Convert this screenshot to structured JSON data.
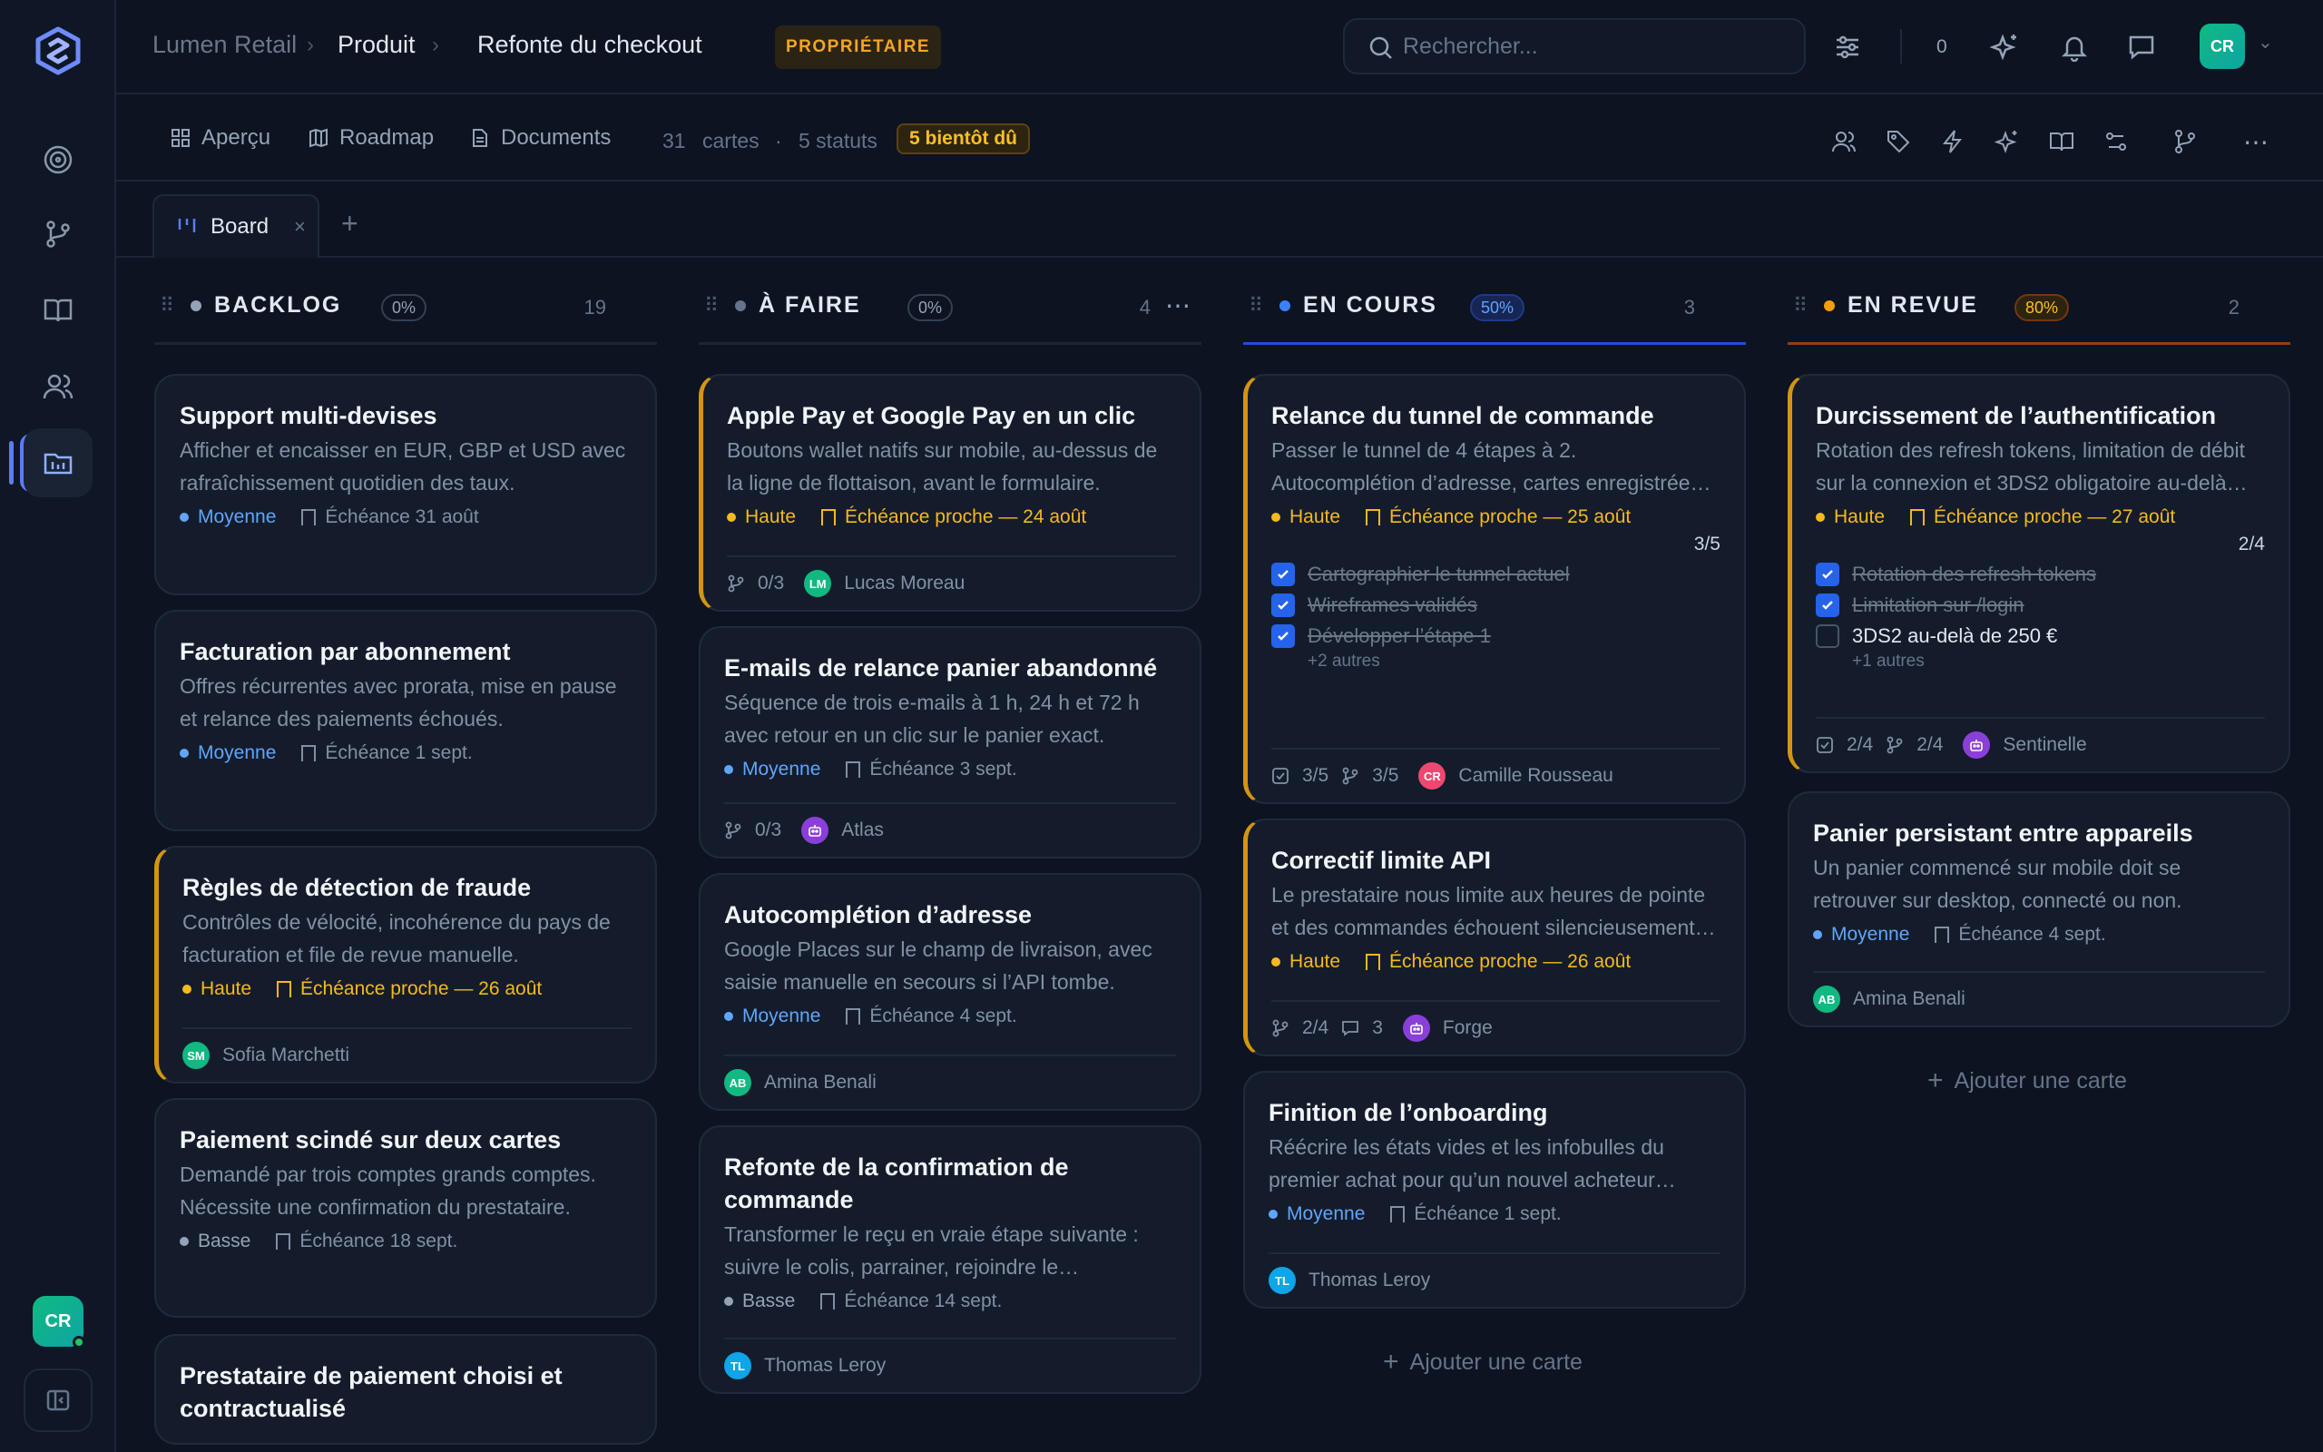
{
  "colors": {
    "accent": "#5b7cf7",
    "high": "#f5b91f",
    "medium": "#60a5fa",
    "low": "#94a3b8",
    "progress_blue": "#3b82f6",
    "review_orange": "#f59e0b"
  },
  "user": {
    "initials": "CR"
  },
  "breadcrumb": {
    "org": "Lumen Retail",
    "section": "Produit",
    "page": "Refonte du checkout",
    "role_badge": "PROPRIÉTAIRE"
  },
  "search": {
    "placeholder": "Rechercher..."
  },
  "topbar": {
    "notif_count": "0"
  },
  "subtabs": [
    {
      "label": "Aperçu",
      "icon": "grid-icon"
    },
    {
      "label": "Roadmap",
      "icon": "map-icon"
    },
    {
      "label": "Documents",
      "icon": "document-icon"
    }
  ],
  "stats": {
    "cards": "31",
    "cards_label": "cartes",
    "statuses": "5 statuts",
    "due_soon": "5 bientôt dû"
  },
  "view": {
    "tab_label": "Board"
  },
  "columns": [
    {
      "title": "BACKLOG",
      "percent": "0%",
      "count": "19",
      "dot": "#94a3b8",
      "cards": [
        {
          "title": "Support multi-devises",
          "desc": "Afficher et encaisser en EUR, GBP et USD avec rafraîchissement quotidien des taux.",
          "priority": "Moyenne",
          "due": "Échéance 31 août"
        },
        {
          "title": "Facturation par abonnement",
          "desc": "Offres récurrentes avec prorata, mise en pause et relance des paiements échoués.",
          "priority": "Moyenne",
          "due": "Échéance 1 sept."
        },
        {
          "title": "Règles de détection de fraude",
          "desc": "Contrôles de vélocité, incohérence du pays de facturation et file de revue manuelle.",
          "priority": "Haute",
          "due": "Échéance proche — 26 août",
          "assignee": "Sofia Marchetti",
          "assignee_initials": "SM"
        },
        {
          "title": "Paiement scindé sur deux cartes",
          "desc": "Demandé par trois comptes grands comptes. Nécessite une confirmation du prestataire.",
          "priority": "Basse",
          "due": "Échéance 18 sept."
        },
        {
          "title": "Prestataire de paiement choisi et contractualisé"
        }
      ]
    },
    {
      "title": "À FAIRE",
      "percent": "0%",
      "count": "4",
      "dot": "#64748b",
      "cards": [
        {
          "title": "Apple Pay et Google Pay en un clic",
          "desc": "Boutons wallet natifs sur mobile, au-dessus de la ligne de flottaison, avant le formulaire.",
          "priority": "Haute",
          "due": "Échéance proche — 24 août",
          "branches": "0/3",
          "assignee": "Lucas Moreau",
          "assignee_initials": "LM"
        },
        {
          "title": "E-mails de relance panier abandonné",
          "desc": "Séquence de trois e-mails à 1 h, 24 h et 72 h avec retour en un clic sur le panier exact.",
          "priority": "Moyenne",
          "due": "Échéance 3 sept.",
          "branches": "0/3",
          "assignee": "Atlas"
        },
        {
          "title": "Autocomplétion d’adresse",
          "desc": "Google Places sur le champ de livraison, avec saisie manuelle en secours si l’API tombe.",
          "priority": "Moyenne",
          "due": "Échéance 4 sept.",
          "assignee": "Amina Benali",
          "assignee_initials": "AB"
        },
        {
          "title": "Refonte de la confirmation de commande",
          "desc": "Transformer le reçu en vraie étape suivante : suivre le colis, parrainer, rejoindre le…",
          "priority": "Basse",
          "due": "Échéance 14 sept.",
          "assignee": "Thomas Leroy",
          "assignee_initials": "TL"
        }
      ]
    },
    {
      "title": "EN COURS",
      "percent": "50%",
      "count": "3",
      "dot": "#3b82f6",
      "cards": [
        {
          "title": "Relance du tunnel de commande",
          "desc": "Passer le tunnel de 4 étapes à 2. Autocomplétion d’adresse, cartes enregistrée…",
          "priority": "Haute",
          "due": "Échéance proche — 25 août",
          "progress": "3/5",
          "checklist": [
            "Cartographier le tunnel actuel",
            "Wireframes validés",
            "Développer l’étape 1"
          ],
          "more": "+2 autres",
          "tasks": "3/5",
          "branches": "3/5",
          "assignee": "Camille Rousseau",
          "assignee_initials": "CR"
        },
        {
          "title": "Correctif limite API",
          "desc": "Le prestataire nous limite aux heures de pointe et des commandes échouent silencieusement…",
          "priority": "Haute",
          "due": "Échéance proche — 26 août",
          "branches": "2/4",
          "comments": "3",
          "assignee": "Forge"
        },
        {
          "title": "Finition de l’onboarding",
          "desc": "Réécrire les états vides et les infobulles du premier achat pour qu’un nouvel acheteur…",
          "priority": "Moyenne",
          "due": "Échéance 1 sept.",
          "assignee": "Thomas Leroy",
          "assignee_initials": "TL"
        }
      ]
    },
    {
      "title": "EN REVUE",
      "percent": "80%",
      "count": "2",
      "dot": "#f59e0b",
      "cards": [
        {
          "title": "Durcissement de l’authentification",
          "desc": "Rotation des refresh tokens, limitation de débit sur la connexion et 3DS2 obligatoire au-delà…",
          "priority": "Haute",
          "due": "Échéance proche — 27 août",
          "progress": "2/4",
          "checklist": [
            "Rotation des refresh tokens",
            "Limitation sur /login",
            "3DS2 au-delà de 250 €"
          ],
          "more": "+1 autres",
          "tasks": "2/4",
          "branches": "2/4",
          "assignee": "Sentinelle"
        },
        {
          "title": "Panier persistant entre appareils",
          "desc": "Un panier commencé sur mobile doit se retrouver sur desktop, connecté ou non.",
          "priority": "Moyenne",
          "due": "Échéance 4 sept.",
          "assignee": "Amina Benali",
          "assignee_initials": "AB"
        }
      ]
    }
  ],
  "add_card_label": "Ajouter une carte"
}
